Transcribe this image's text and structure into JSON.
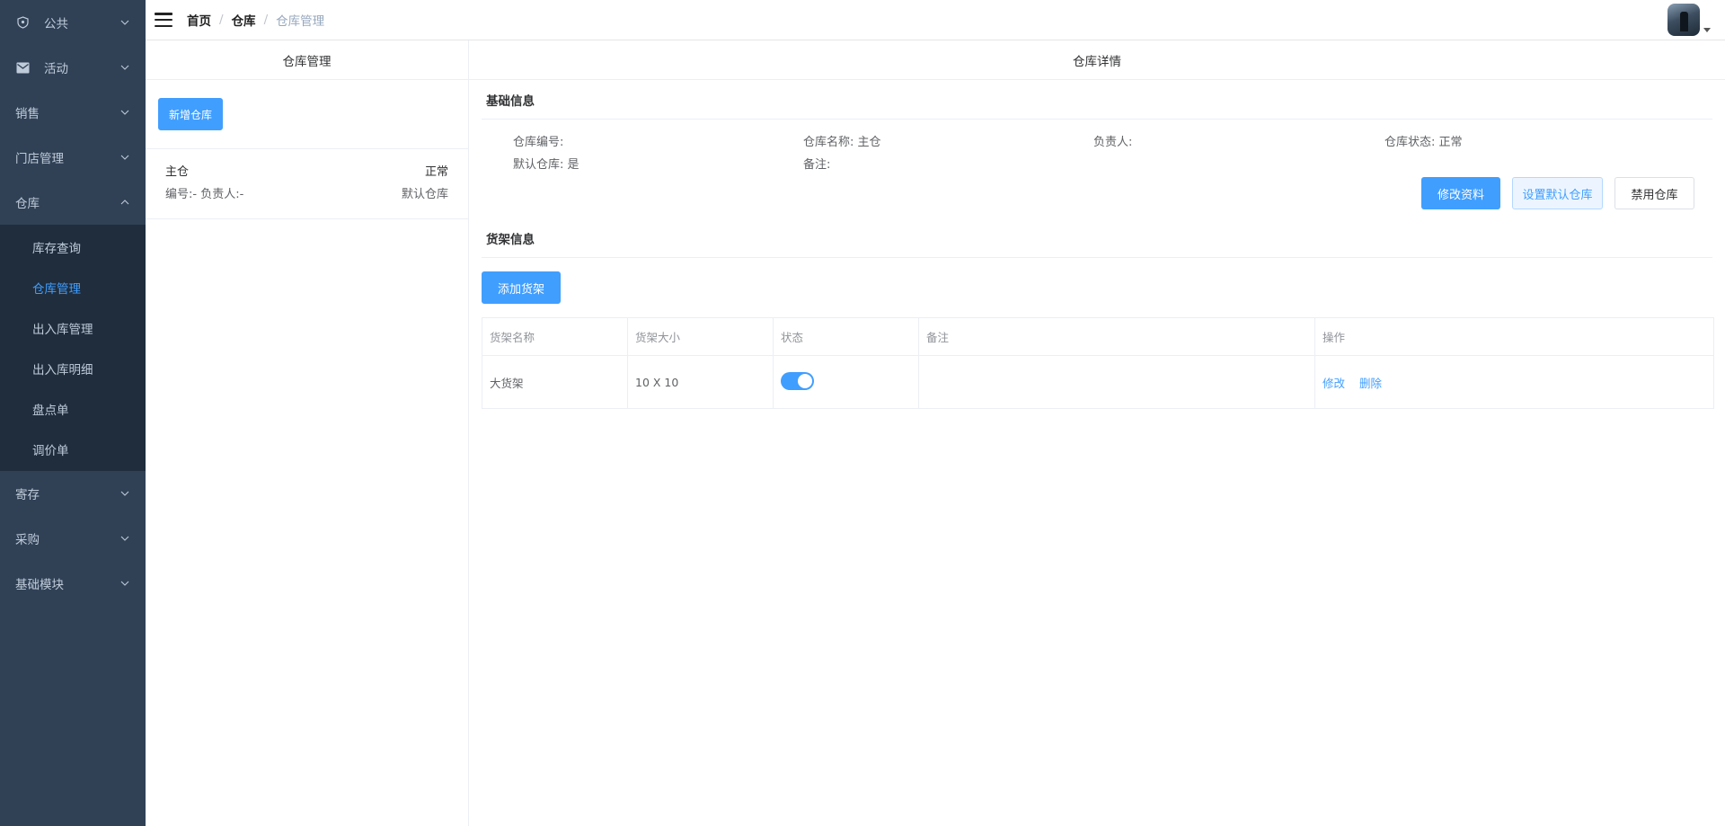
{
  "sidebar": {
    "items": [
      {
        "label": "公共",
        "icon": "shield-icon"
      },
      {
        "label": "活动",
        "icon": "mail-icon"
      },
      {
        "label": "销售"
      },
      {
        "label": "门店管理"
      },
      {
        "label": "仓库",
        "expanded": true
      },
      {
        "label": "寄存"
      },
      {
        "label": "采购"
      },
      {
        "label": "基础模块"
      }
    ],
    "warehouse_submenu": [
      "库存查询",
      "仓库管理",
      "出入库管理",
      "出入库明细",
      "盘点单",
      "调价单"
    ],
    "active_submenu": "仓库管理"
  },
  "breadcrumb": [
    "首页",
    "仓库",
    "仓库管理"
  ],
  "left_panel": {
    "title": "仓库管理",
    "add_button": "新增仓库",
    "warehouses": [
      {
        "name": "主仓",
        "status": "正常",
        "meta": "编号:- 负责人:-",
        "tag": "默认仓库"
      }
    ]
  },
  "right_panel": {
    "title": "仓库详情",
    "basic_title": "基础信息",
    "fields": {
      "code": "仓库编号:",
      "name": "仓库名称: 主仓",
      "manager": "负责人:",
      "status": "仓库状态: 正常",
      "is_default": "默认仓库: 是",
      "remark": "备注:"
    },
    "buttons": {
      "edit": "修改资料",
      "set_default": "设置默认仓库",
      "disable": "禁用仓库"
    },
    "shelf_title": "货架信息",
    "add_shelf": "添加货架",
    "table": {
      "headers": [
        "货架名称",
        "货架大小",
        "状态",
        "备注",
        "操作"
      ],
      "rows": [
        {
          "name": "大货架",
          "size": "10 X 10",
          "enabled": true,
          "remark": "",
          "actions": [
            "修改",
            "删除"
          ]
        }
      ]
    }
  },
  "colors": {
    "sidebar_bg": "#304156",
    "submenu_bg": "#1f2d3d",
    "accent": "#409eff"
  }
}
